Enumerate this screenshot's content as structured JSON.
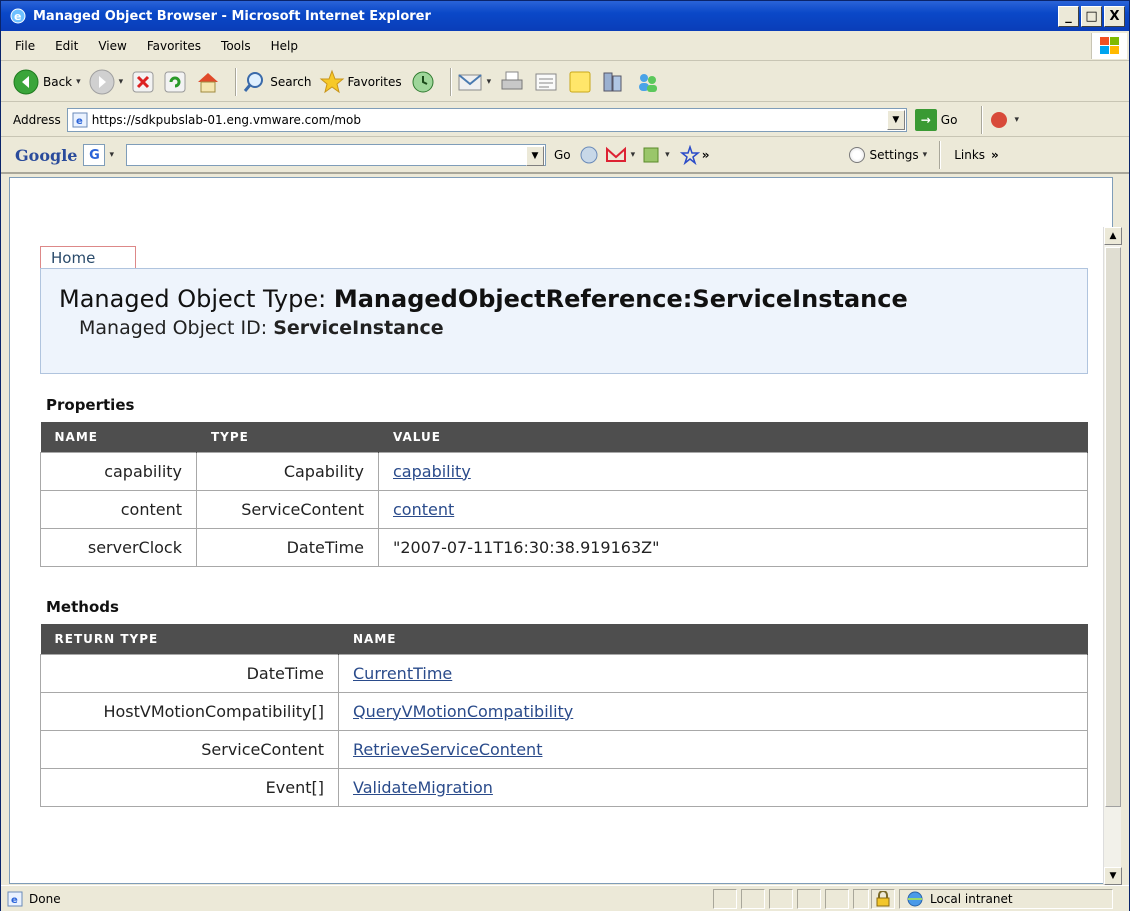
{
  "window": {
    "title": "Managed Object Browser - Microsoft Internet Explorer",
    "minimize": "_",
    "maximize": "□",
    "close": "X"
  },
  "menu": {
    "items": [
      "File",
      "Edit",
      "View",
      "Favorites",
      "Tools",
      "Help"
    ]
  },
  "toolbar": {
    "back_label": "Back",
    "search_label": "Search",
    "favorites_label": "Favorites"
  },
  "address": {
    "label": "Address",
    "url": "https://sdkpubslab-01.eng.vmware.com/mob",
    "go_label": "Go"
  },
  "google_toolbar": {
    "logo": "Google",
    "g_button": "G",
    "go_label": "Go",
    "settings_label": "Settings",
    "links_label": "Links"
  },
  "page": {
    "home_tab": "Home",
    "managed_object_type_label": "Managed Object Type:",
    "managed_object_type_value": "ManagedObjectReference:ServiceInstance",
    "managed_object_id_label": "Managed Object ID:",
    "managed_object_id_value": "ServiceInstance",
    "properties_title": "Properties",
    "properties_headers": [
      "NAME",
      "TYPE",
      "VALUE"
    ],
    "properties": [
      {
        "name": "capability",
        "type": "Capability",
        "value": "capability"
      },
      {
        "name": "content",
        "type": "ServiceContent",
        "value": "content"
      },
      {
        "name": "serverClock",
        "type": "DateTime",
        "value": "\"2007-07-11T16:30:38.919163Z\""
      }
    ],
    "methods_title": "Methods",
    "methods_headers": [
      "RETURN TYPE",
      "NAME"
    ],
    "methods": [
      {
        "return_type": "DateTime",
        "name": "CurrentTime"
      },
      {
        "return_type": "HostVMotionCompatibility[]",
        "name": "QueryVMotionCompatibility"
      },
      {
        "return_type": "ServiceContent",
        "name": "RetrieveServiceContent"
      },
      {
        "return_type": "Event[]",
        "name": "ValidateMigration"
      }
    ]
  },
  "status": {
    "text": "Done",
    "zone": "Local intranet"
  }
}
